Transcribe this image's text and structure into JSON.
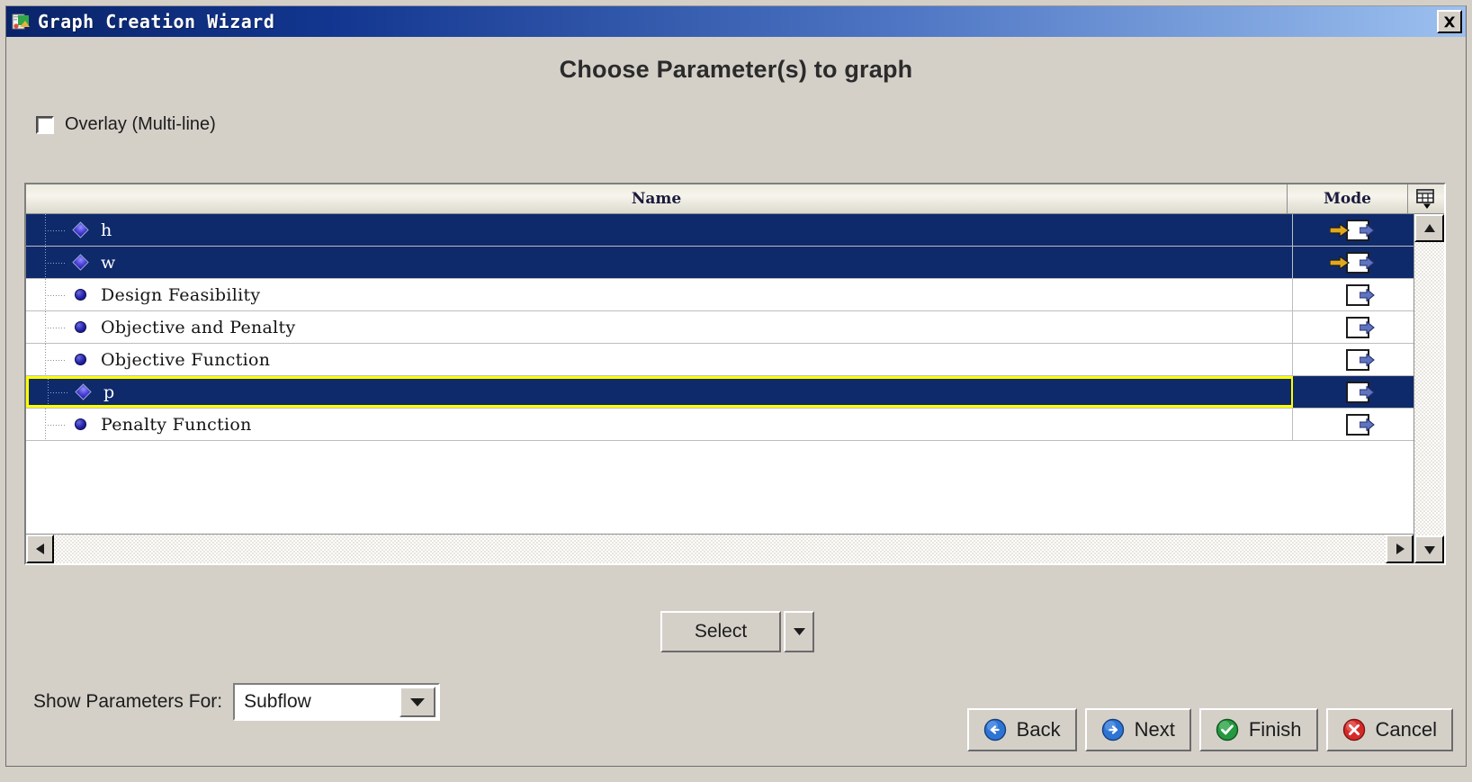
{
  "window": {
    "title": "Graph Creation Wizard",
    "icon": "graph-wizard-icon",
    "close_label": "×"
  },
  "page": {
    "title": "Choose Parameter(s) to graph"
  },
  "overlay": {
    "label": "Overlay (Multi-line)",
    "checked": false
  },
  "table": {
    "columns": [
      {
        "key": "name",
        "label": "Name"
      },
      {
        "key": "mode",
        "label": "Mode"
      }
    ],
    "grid_icon": "table-settings-icon",
    "rows": [
      {
        "name": "h",
        "node": "diamond",
        "state": "selected",
        "mode": "gold-blue-arrow"
      },
      {
        "name": "w",
        "node": "diamond",
        "state": "selected",
        "mode": "gold-blue-arrow"
      },
      {
        "name": "Design Feasibility",
        "node": "circle",
        "state": "normal",
        "mode": "blue-arrow"
      },
      {
        "name": "Objective and Penalty",
        "node": "circle",
        "state": "normal",
        "mode": "blue-arrow"
      },
      {
        "name": "Objective Function",
        "node": "circle",
        "state": "normal",
        "mode": "blue-arrow"
      },
      {
        "name": "p",
        "node": "diamond",
        "state": "focused",
        "mode": "blue-arrow"
      },
      {
        "name": "Penalty Function",
        "node": "circle",
        "state": "normal",
        "mode": "blue-arrow"
      }
    ]
  },
  "select_button": {
    "label": "Select",
    "dropdown_icon": "chevron-down-icon"
  },
  "show_parameters": {
    "label": "Show Parameters For:",
    "value": "Subflow",
    "dropdown_icon": "chevron-down-icon"
  },
  "footer": {
    "back": {
      "label": "Back",
      "icon": "arrow-left-circle-icon"
    },
    "next": {
      "label": "Next",
      "icon": "arrow-right-circle-icon"
    },
    "finish": {
      "label": "Finish",
      "icon": "check-circle-icon"
    },
    "cancel": {
      "label": "Cancel",
      "icon": "x-circle-icon"
    }
  },
  "colors": {
    "title_bar_start": "#0a246a",
    "title_bar_end": "#9cc0ef",
    "selection": "#0f2a6b",
    "focus_outline": "#ffff00",
    "face": "#d4d0c8",
    "header": "#f0eee4"
  }
}
